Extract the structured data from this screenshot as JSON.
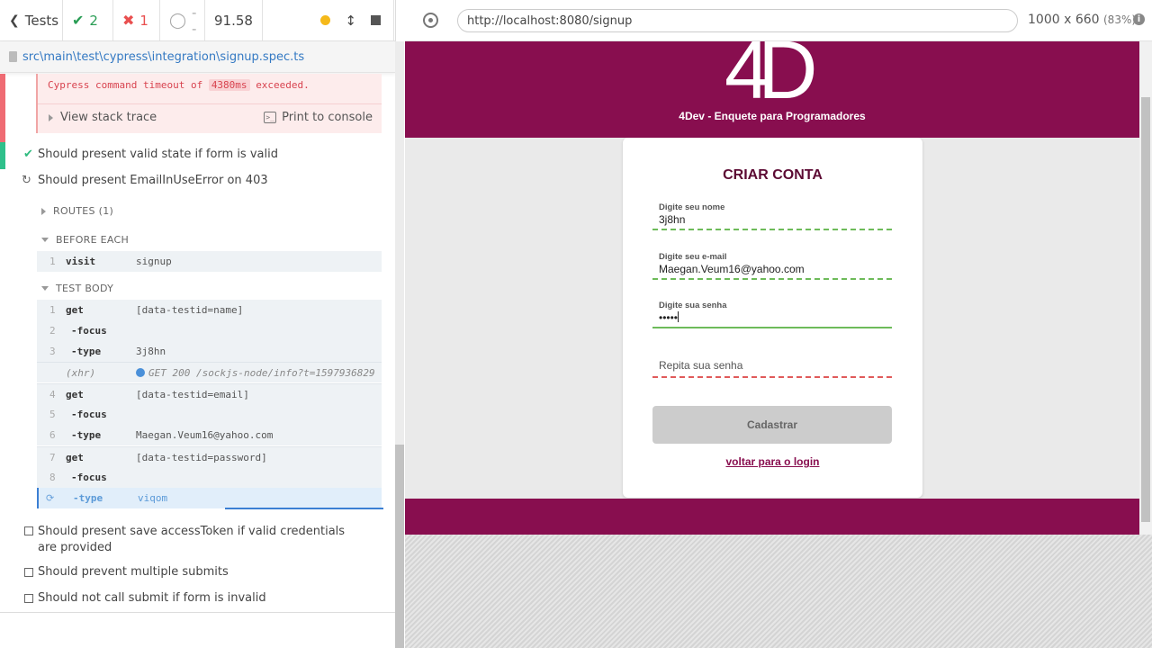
{
  "stats": {
    "back_label": "Tests",
    "passed": "2",
    "failed": "1",
    "pending": "--",
    "duration": "91.58",
    "colors": {
      "passed": "#2a9d55",
      "failed": "#e94f4f",
      "running": "#f5b91a"
    }
  },
  "spec": {
    "path": "src\\main\\test\\cypress\\integration\\signup.spec.ts"
  },
  "error": {
    "prefix": "Cypress command timeout of",
    "timeout": "4380ms",
    "suffix": "exceeded.",
    "stack_trace": "View stack trace",
    "print": "Print to console",
    "print_icon": ">_"
  },
  "tests": [
    {
      "title": "Should present valid state if form is valid",
      "state": "passed"
    },
    {
      "title": "Should present EmailInUseError on 403",
      "state": "running"
    }
  ],
  "hooks": {
    "routes": "ROUTES (1)",
    "before_each": "BEFORE EACH",
    "test_body": "TEST BODY"
  },
  "before_each_cmds": [
    {
      "num": "1",
      "name": "visit",
      "msg": "signup"
    }
  ],
  "commands": [
    {
      "num": "1",
      "name": "get",
      "msg": "[data-testid=name]"
    },
    {
      "num": "2",
      "name": "-focus",
      "msg": ""
    },
    {
      "num": "3",
      "name": "-type",
      "msg": "3j8hn"
    },
    {
      "num": "",
      "name": "(xhr)",
      "msg": "GET 200 /sockjs-node/info?t=1597936829"
    },
    {
      "num": "4",
      "name": "get",
      "msg": "[data-testid=email]"
    },
    {
      "num": "5",
      "name": "-focus",
      "msg": ""
    },
    {
      "num": "6",
      "name": "-type",
      "msg": "Maegan.Veum16@yahoo.com"
    },
    {
      "num": "7",
      "name": "get",
      "msg": "[data-testid=password]"
    },
    {
      "num": "8",
      "name": "-focus",
      "msg": ""
    },
    {
      "num": "",
      "name": "-type",
      "msg": "viqom"
    }
  ],
  "pending_tests": [
    "Should present save accessToken if valid credentials are provided",
    "Should prevent multiple submits",
    "Should not call submit if form is invalid"
  ],
  "aut": {
    "url": "http://localhost:8080/signup",
    "viewport": "1000 x 660",
    "scale": "(83%)",
    "info_icon": "i"
  },
  "site": {
    "logo": "4D",
    "subtitle": "4Dev - Enquete para Programadores",
    "title": "CRIAR CONTA",
    "fields": [
      {
        "label": "Digite seu nome",
        "value": "3j8hn"
      },
      {
        "label": "Digite seu e-mail",
        "value": "Maegan.Veum16@yahoo.com"
      },
      {
        "label": "Digite sua senha",
        "value": "•••••"
      },
      {
        "label": "",
        "placeholder": "Repita sua senha"
      }
    ],
    "submit": "Cadastrar",
    "back_link": "voltar para o login",
    "brand_color": "#880e4f"
  }
}
